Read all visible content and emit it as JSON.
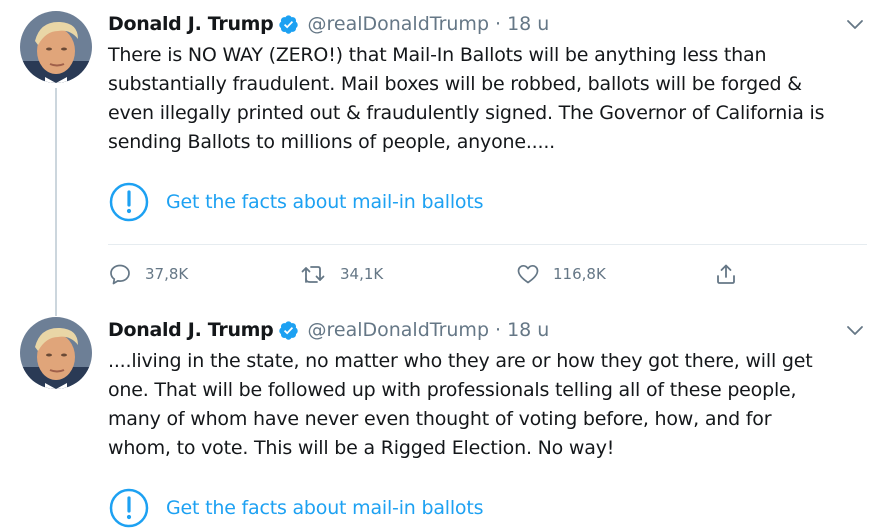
{
  "colors": {
    "accent": "#1da1f2",
    "secondary": "#657786",
    "text": "#14171a",
    "divider": "#e6ecf0"
  },
  "tweets": [
    {
      "author": {
        "name": "Donald J. Trump",
        "handle": "@realDonaldTrump",
        "verified": true
      },
      "time": "18 u",
      "separator": "·",
      "text": "There is NO WAY (ZERO!) that Mail-In Ballots will be anything less than\nsubstantially fraudulent. Mail boxes will be robbed, ballots will be forged &\neven illegally printed out & fraudulently signed. The Governor of California is\nsending Ballots to millions of people, anyone.....",
      "facts_label": "Get the facts about mail-in ballots",
      "stats": {
        "replies": "37,8K",
        "retweets": "34,1K",
        "likes": "116,8K"
      },
      "icons": [
        "reply-icon",
        "retweet-icon",
        "heart-icon",
        "share-icon"
      ]
    },
    {
      "author": {
        "name": "Donald J. Trump",
        "handle": "@realDonaldTrump",
        "verified": true
      },
      "time": "18 u",
      "separator": "·",
      "text": "....living in the state, no matter who they are or how they got there, will get\none. That will be followed up with professionals telling all of these people,\nmany of whom have never even thought of voting before, how, and for\nwhom, to vote. This will be a Rigged Election. No way!",
      "facts_label": "Get the facts about mail-in ballots"
    }
  ]
}
